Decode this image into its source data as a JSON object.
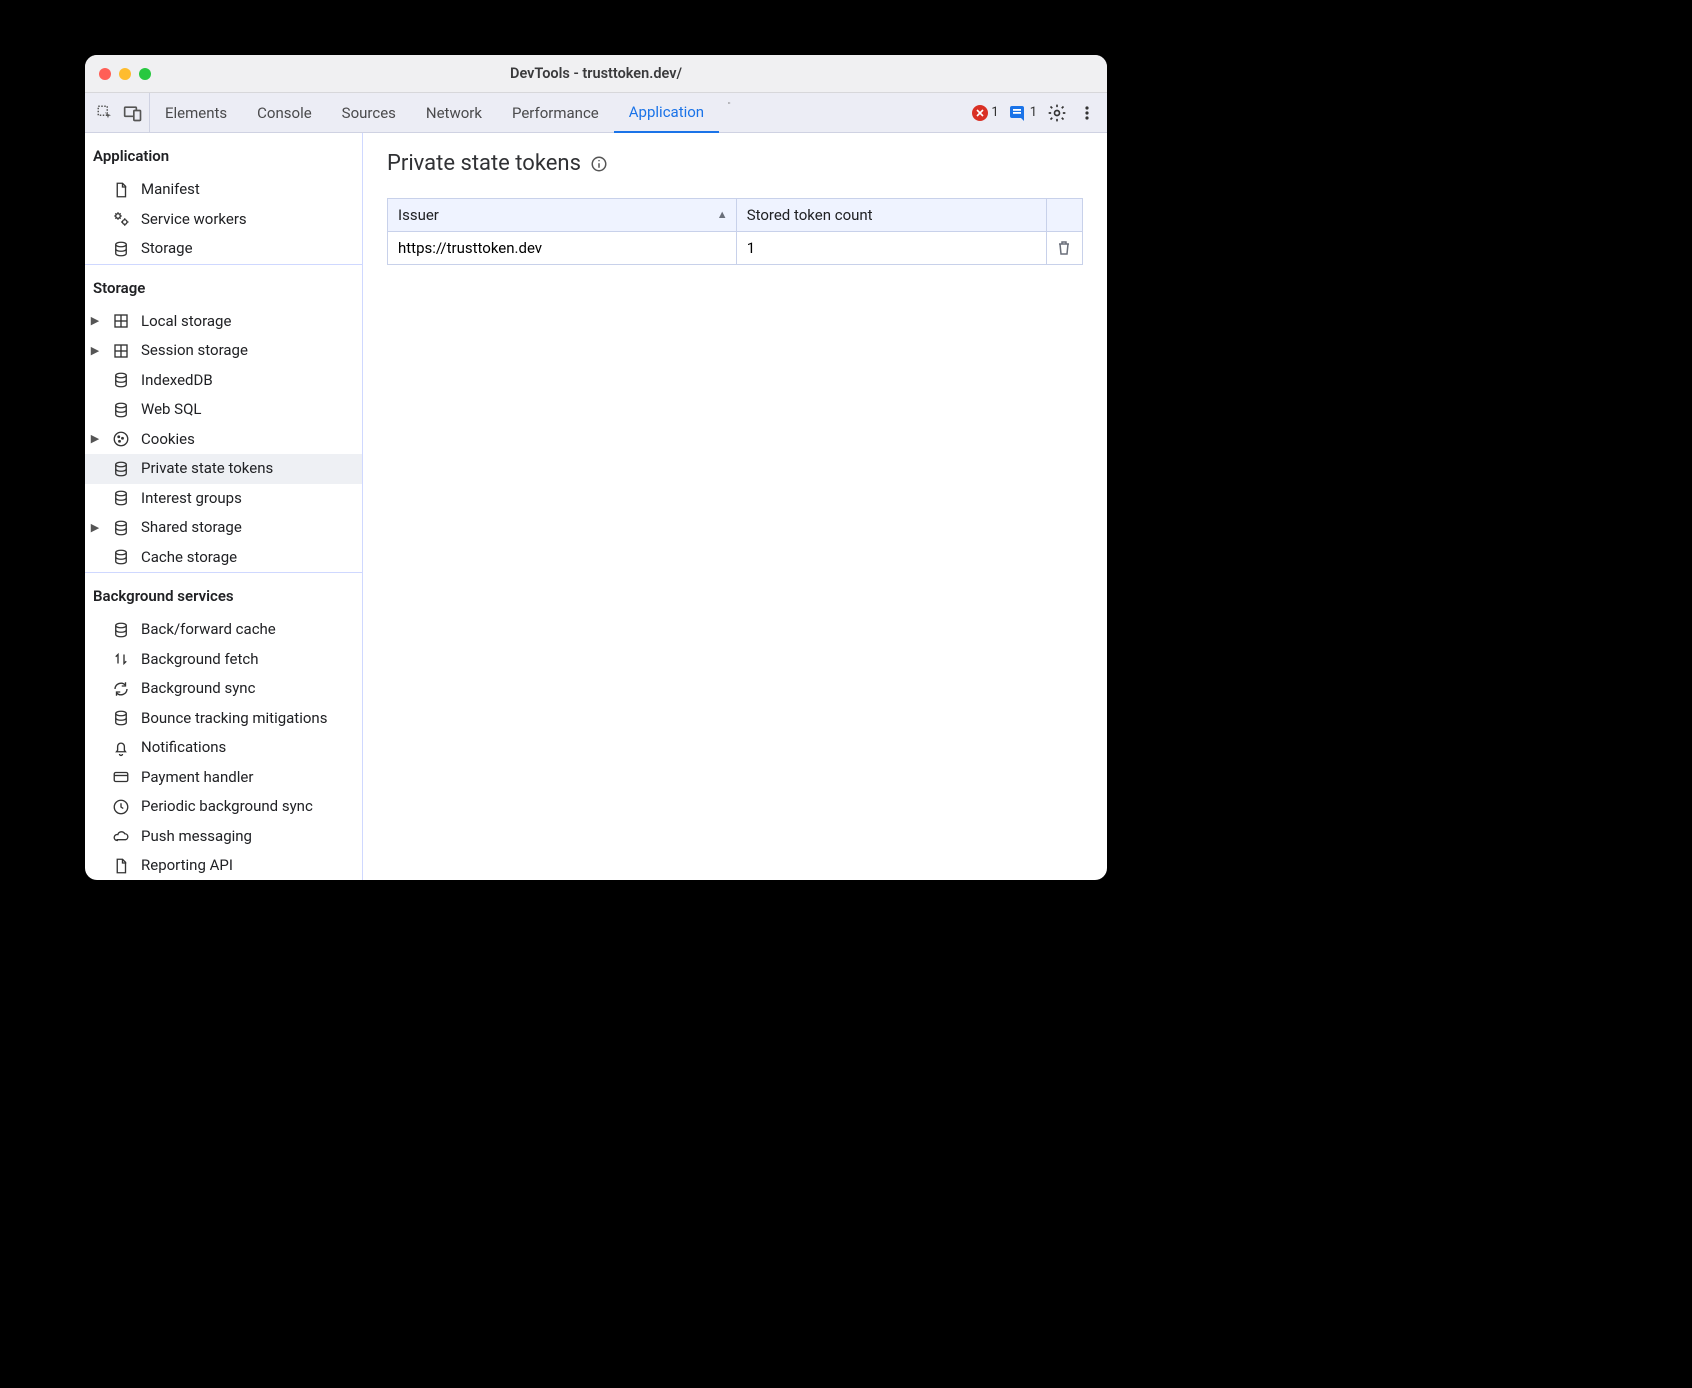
{
  "window": {
    "title": "DevTools - trusttoken.dev/"
  },
  "tabbar": {
    "tabs": [
      "Elements",
      "Console",
      "Sources",
      "Network",
      "Performance",
      "Application"
    ],
    "active": "Application",
    "errors": "1",
    "issues": "1"
  },
  "sidebar": {
    "sections": [
      {
        "title": "Application",
        "items": [
          {
            "label": "Manifest",
            "icon": "file",
            "arrow": false
          },
          {
            "label": "Service workers",
            "icon": "gears",
            "arrow": false
          },
          {
            "label": "Storage",
            "icon": "db",
            "arrow": false
          }
        ]
      },
      {
        "title": "Storage",
        "items": [
          {
            "label": "Local storage",
            "icon": "grid",
            "arrow": true
          },
          {
            "label": "Session storage",
            "icon": "grid",
            "arrow": true
          },
          {
            "label": "IndexedDB",
            "icon": "db",
            "arrow": false
          },
          {
            "label": "Web SQL",
            "icon": "db",
            "arrow": false
          },
          {
            "label": "Cookies",
            "icon": "cookie",
            "arrow": true
          },
          {
            "label": "Private state tokens",
            "icon": "db",
            "arrow": false,
            "selected": true
          },
          {
            "label": "Interest groups",
            "icon": "db",
            "arrow": false
          },
          {
            "label": "Shared storage",
            "icon": "db",
            "arrow": true
          },
          {
            "label": "Cache storage",
            "icon": "db",
            "arrow": false
          }
        ]
      },
      {
        "title": "Background services",
        "items": [
          {
            "label": "Back/forward cache",
            "icon": "db",
            "arrow": false
          },
          {
            "label": "Background fetch",
            "icon": "updown",
            "arrow": false
          },
          {
            "label": "Background sync",
            "icon": "sync",
            "arrow": false
          },
          {
            "label": "Bounce tracking mitigations",
            "icon": "db",
            "arrow": false
          },
          {
            "label": "Notifications",
            "icon": "bell",
            "arrow": false
          },
          {
            "label": "Payment handler",
            "icon": "card",
            "arrow": false
          },
          {
            "label": "Periodic background sync",
            "icon": "clock",
            "arrow": false
          },
          {
            "label": "Push messaging",
            "icon": "cloud",
            "arrow": false
          },
          {
            "label": "Reporting API",
            "icon": "file",
            "arrow": false
          }
        ]
      }
    ]
  },
  "main": {
    "title": "Private state tokens",
    "columns": [
      "Issuer",
      "Stored token count"
    ],
    "rows": [
      {
        "issuer": "https://trusttoken.dev",
        "count": "1"
      }
    ]
  }
}
